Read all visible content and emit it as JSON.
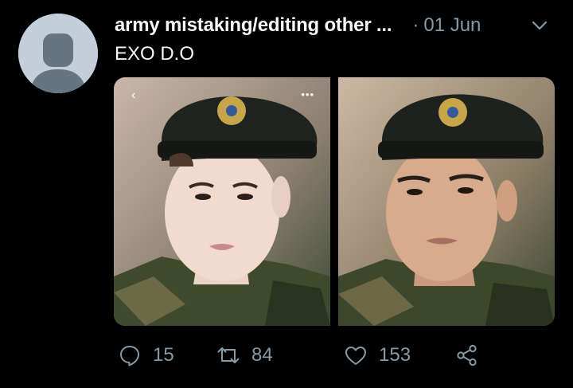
{
  "tweet": {
    "author_name": "army mistaking/editing other ...",
    "separator": "·",
    "date": "01 Jun",
    "text": "EXO D.O"
  },
  "media": {
    "left_overlay_back": "‹",
    "left_overlay_more": "•••"
  },
  "actions": {
    "replies": "15",
    "retweets": "84",
    "likes": "153"
  },
  "icons": {
    "reply": "reply-icon",
    "retweet": "retweet-icon",
    "like": "heart-icon",
    "share": "share-icon",
    "menu": "chevron-down-icon"
  },
  "colors": {
    "background": "#000000",
    "primary_text": "#f5f8fa",
    "secondary_text": "#8899a6",
    "avatar_bg": "#c4cfd9"
  }
}
